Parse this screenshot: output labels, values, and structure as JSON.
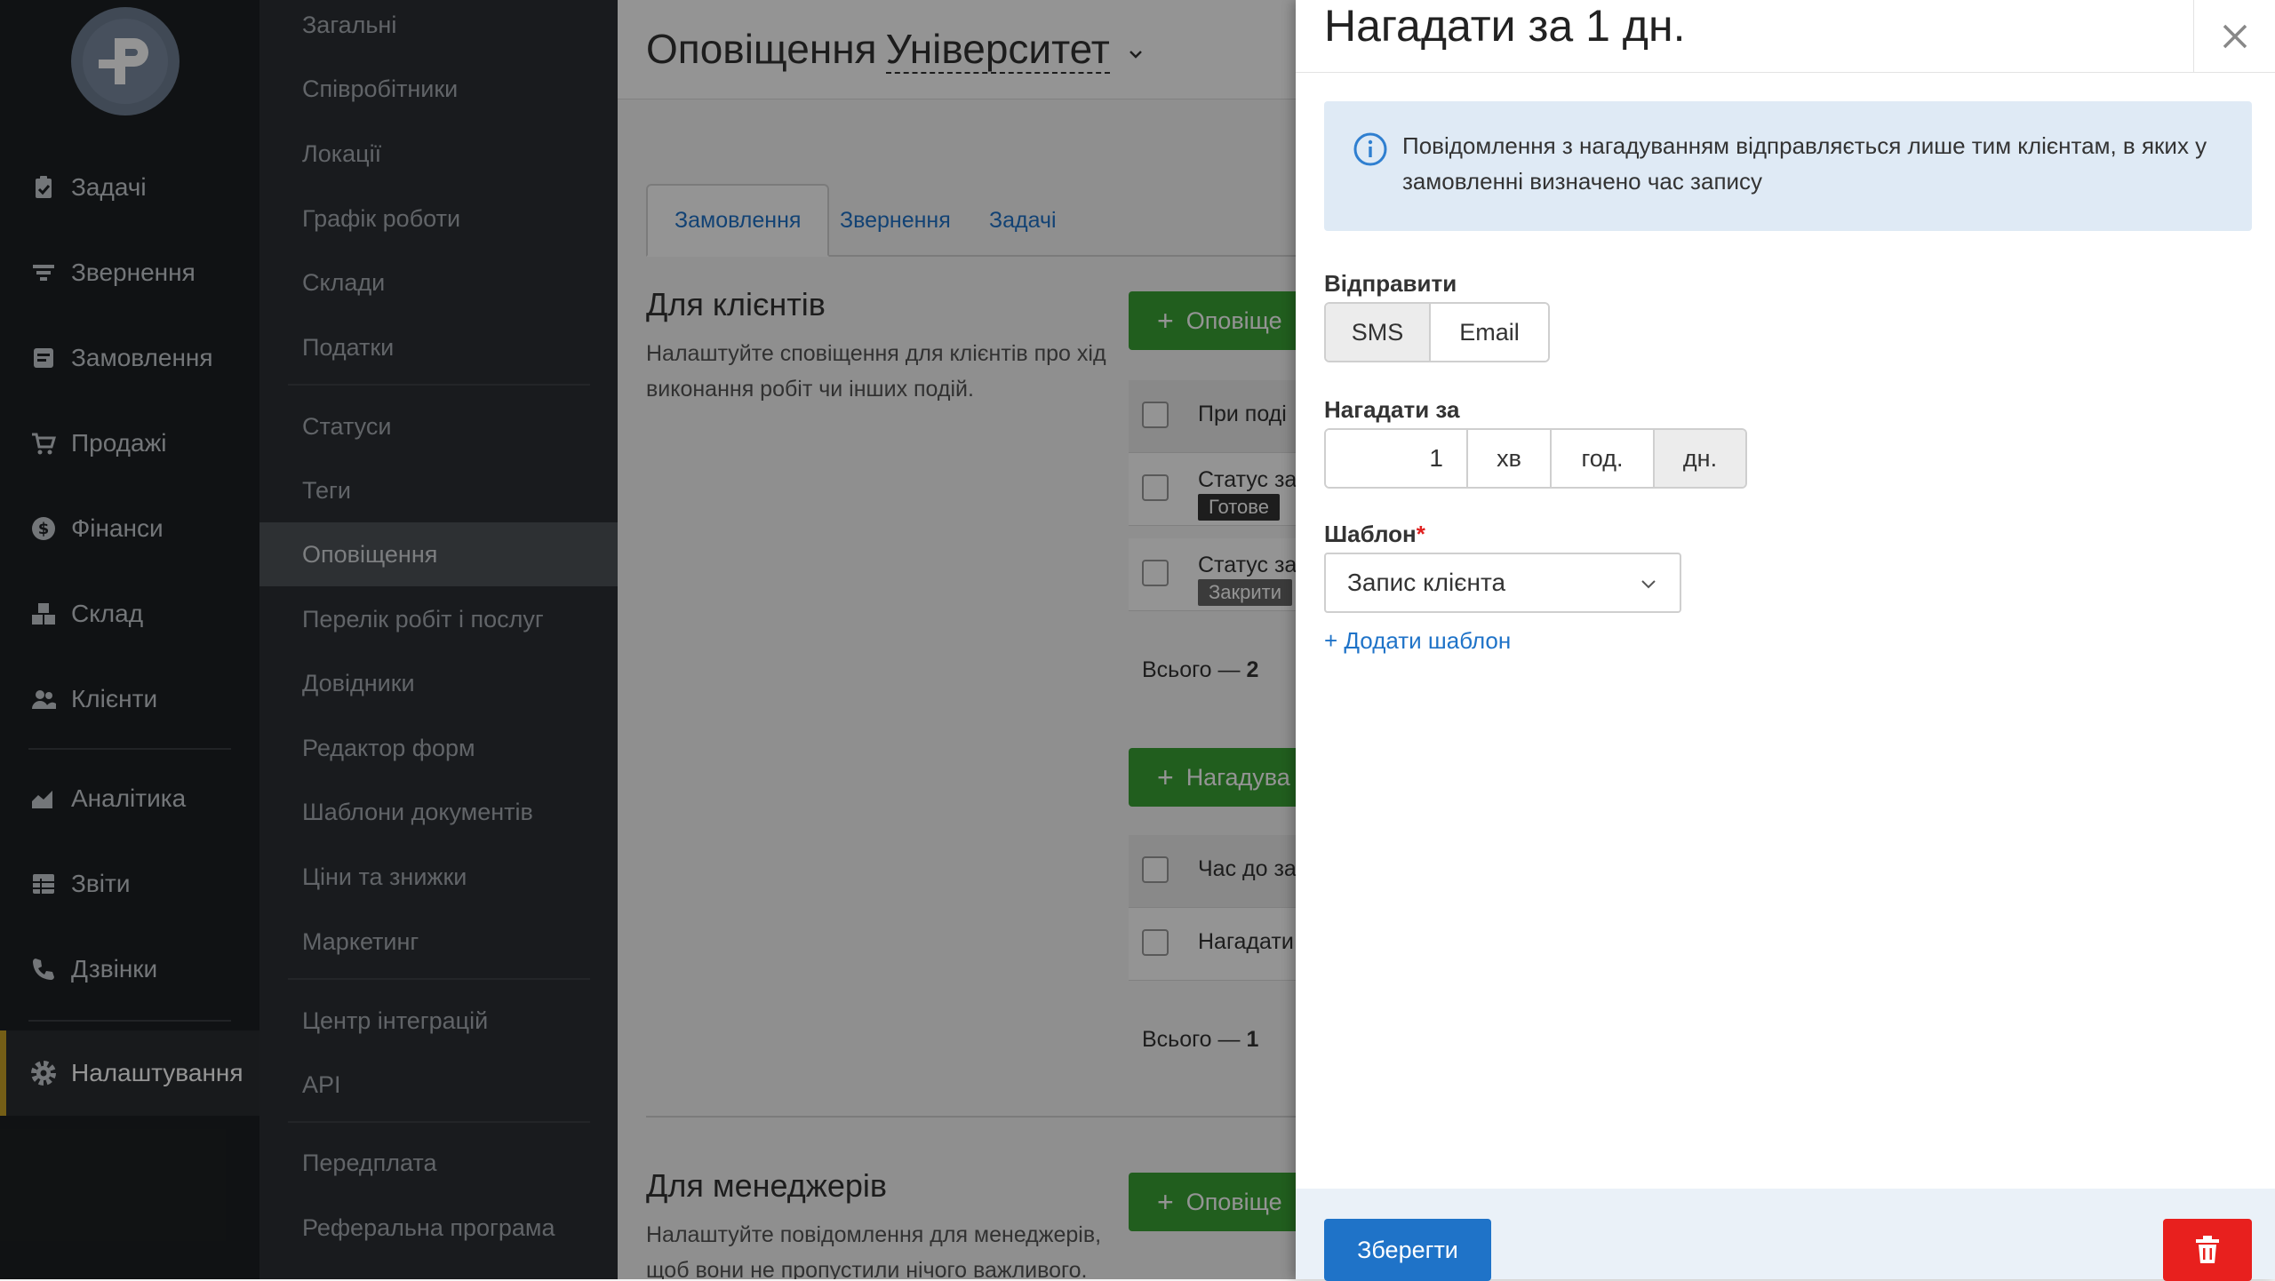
{
  "nav": {
    "items": [
      {
        "label": "Задачі",
        "icon": "clipboard-icon"
      },
      {
        "label": "Звернення",
        "icon": "funnel-icon"
      },
      {
        "label": "Замовлення",
        "icon": "order-icon"
      },
      {
        "label": "Продажі",
        "icon": "cart-icon"
      },
      {
        "label": "Фінанси",
        "icon": "dollar-icon"
      },
      {
        "label": "Склад",
        "icon": "boxes-icon"
      },
      {
        "label": "Клієнти",
        "icon": "users-icon"
      },
      {
        "label": "Аналітика",
        "icon": "chart-icon"
      },
      {
        "label": "Звіти",
        "icon": "table-icon"
      },
      {
        "label": "Дзвінки",
        "icon": "phone-icon"
      },
      {
        "label": "Налаштування",
        "icon": "gear-icon"
      }
    ],
    "active": "Налаштування",
    "accent": "#c9a227"
  },
  "submenu": {
    "items": [
      "Загальні",
      "Співробітники",
      "Локації",
      "Графік роботи",
      "Склади",
      "Податки",
      "Статуси",
      "Теги",
      "Оповіщення",
      "Перелік робіт і послуг",
      "Довідники",
      "Редактор форм",
      "Шаблони документів",
      "Ціни та знижки",
      "Маркетинг",
      "Центр інтеграцій",
      "API",
      "Передплата",
      "Реферальна програма"
    ],
    "active": "Оповіщення"
  },
  "main": {
    "title": "Оповіщення",
    "location": "Університет",
    "tabs": [
      "Замовлення",
      "Звернення",
      "Задачі"
    ],
    "active_tab": "Замовлення",
    "clients": {
      "title": "Для клієнтів",
      "description": "Налаштуйте сповіщення для клієнтів про хід виконання робіт чи інших подій.",
      "button": "Оповіще",
      "header": "При поді",
      "rows": [
        {
          "text": "Статус за",
          "badge": "Готове"
        },
        {
          "text": "Статус за",
          "badge": "Закрити"
        }
      ],
      "total_label": "Всього — ",
      "total": "2"
    },
    "reminders": {
      "button": "Нагадува",
      "header": "Час до за",
      "rows": [
        {
          "text": "Нагадати"
        }
      ],
      "total_label": "Всього — ",
      "total": "1"
    },
    "managers": {
      "title": "Для менеджерів",
      "description": "Налаштуйте повідомлення для менеджерів, щоб вони не пропустили нічого важливого.",
      "button": "Оповіще"
    }
  },
  "drawer": {
    "title": "Нагадати за 1 дн.",
    "info": "Повідомлення з нагадуванням відправляється лише тим клієнтам, в яких у замовленні визначено час запису",
    "send_label": "Відправити",
    "send_options": [
      "SMS",
      "Email"
    ],
    "send_active": "SMS",
    "remind_label": "Нагадати за",
    "remind_value": "1",
    "remind_units": [
      "хв",
      "год.",
      "дн."
    ],
    "remind_active_unit": "дн.",
    "template_label": "Шаблон",
    "template_required_mark": "*",
    "template_value": "Запис клієнта",
    "add_template": "+ Додати шаблон",
    "save": "Зберегти",
    "colors": {
      "primary": "#1f73c8",
      "danger": "#e8201e",
      "info_bg": "#dfeaf5"
    }
  }
}
